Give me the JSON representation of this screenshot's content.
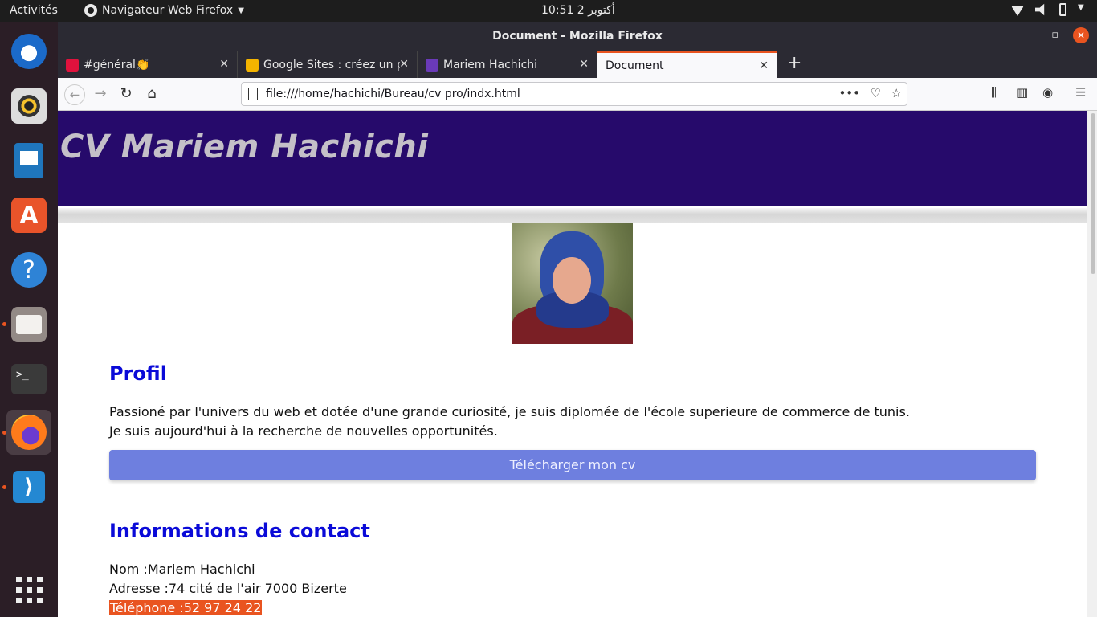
{
  "topbar": {
    "activities": "Activités",
    "app_menu": "Navigateur Web Firefox",
    "clock": "10:51  2 أكتوبر"
  },
  "dock": {
    "items": [
      "thunderbird-icon",
      "rhythmbox-icon",
      "writer-icon",
      "software-icon",
      "help-icon",
      "files-icon",
      "terminal-icon",
      "firefox-icon",
      "vscode-icon",
      "app-grid-icon"
    ]
  },
  "window": {
    "title": "Document - Mozilla Firefox"
  },
  "tabs": [
    {
      "label": "#général👏",
      "color": "#e0123d"
    },
    {
      "label": "Google Sites : créez un p",
      "color": "#f4b400"
    },
    {
      "label": "Mariem Hachichi",
      "color": "#6a3ab8"
    },
    {
      "label": "Document",
      "color": ""
    }
  ],
  "urlbar": {
    "url": "file:///home/hachichi/Bureau/cv pro/indx.html"
  },
  "page": {
    "header_title": "CV Mariem Hachichi",
    "profil_title": "Profil",
    "profil_line1": "Passioné par l'univers du web et dotée d'une grande curiosité, je suis diplomée de l'école superieure de commerce de tunis.",
    "profil_line2": "Je suis aujourd'hui à la recherche de nouvelles opportunités.",
    "download_button": "Télécharger mon cv",
    "contact_title": "Informations de contact",
    "contact_name": "Nom :Mariem Hachichi",
    "contact_address": "Adresse :74 cité de l'air 7000 Bizerte",
    "contact_phone": "Téléphone :52 97 24 22"
  },
  "colors": {
    "header_bg": "#260a6b",
    "section_title": "#0a0ad8",
    "button_bg": "#6e7fdf",
    "highlight": "#e95420"
  }
}
